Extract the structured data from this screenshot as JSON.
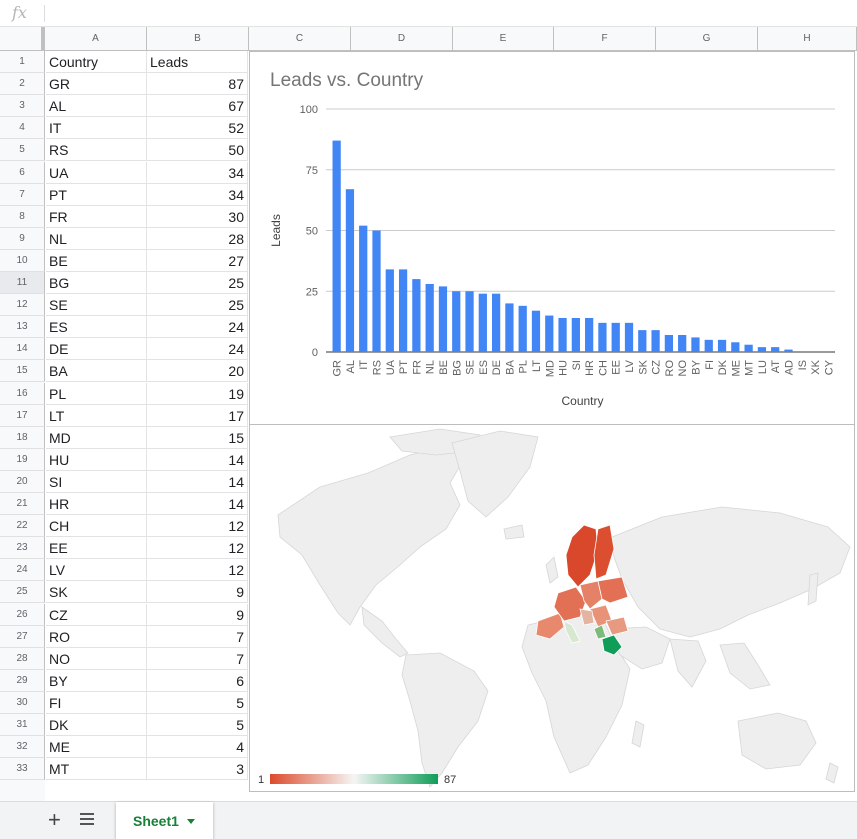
{
  "formula_bar": {
    "icon": "fx",
    "value": ""
  },
  "columns": [
    "A",
    "B",
    "C",
    "D",
    "E",
    "F",
    "G",
    "H"
  ],
  "header_row": {
    "country": "Country",
    "leads": "Leads"
  },
  "rows": [
    {
      "country": "GR",
      "leads": 87
    },
    {
      "country": "AL",
      "leads": 67
    },
    {
      "country": "IT",
      "leads": 52
    },
    {
      "country": "RS",
      "leads": 50
    },
    {
      "country": "UA",
      "leads": 34
    },
    {
      "country": "PT",
      "leads": 34
    },
    {
      "country": "FR",
      "leads": 30
    },
    {
      "country": "NL",
      "leads": 28
    },
    {
      "country": "BE",
      "leads": 27
    },
    {
      "country": "BG",
      "leads": 25
    },
    {
      "country": "SE",
      "leads": 25
    },
    {
      "country": "ES",
      "leads": 24
    },
    {
      "country": "DE",
      "leads": 24
    },
    {
      "country": "BA",
      "leads": 20
    },
    {
      "country": "PL",
      "leads": 19
    },
    {
      "country": "LT",
      "leads": 17
    },
    {
      "country": "MD",
      "leads": 15
    },
    {
      "country": "HU",
      "leads": 14
    },
    {
      "country": "SI",
      "leads": 14
    },
    {
      "country": "HR",
      "leads": 14
    },
    {
      "country": "CH",
      "leads": 12
    },
    {
      "country": "EE",
      "leads": 12
    },
    {
      "country": "LV",
      "leads": 12
    },
    {
      "country": "SK",
      "leads": 9
    },
    {
      "country": "CZ",
      "leads": 9
    },
    {
      "country": "RO",
      "leads": 7
    },
    {
      "country": "NO",
      "leads": 7
    },
    {
      "country": "BY",
      "leads": 6
    },
    {
      "country": "FI",
      "leads": 5
    },
    {
      "country": "DK",
      "leads": 5
    },
    {
      "country": "ME",
      "leads": 4
    },
    {
      "country": "MT",
      "leads": 3
    }
  ],
  "selected_row": 11,
  "chart_data": [
    {
      "type": "bar",
      "title": "Leads vs. Country",
      "xlabel": "Country",
      "ylabel": "Leads",
      "ylim": [
        0,
        100
      ],
      "yticks": [
        0,
        25,
        50,
        75,
        100
      ],
      "grid": true,
      "color": "#4285f4",
      "categories": [
        "GR",
        "AL",
        "IT",
        "RS",
        "UA",
        "PT",
        "FR",
        "NL",
        "BE",
        "BG",
        "SE",
        "ES",
        "DE",
        "BA",
        "PL",
        "LT",
        "MD",
        "HU",
        "SI",
        "HR",
        "CH",
        "EE",
        "LV",
        "SK",
        "CZ",
        "RO",
        "NO",
        "BY",
        "FI",
        "DK",
        "ME",
        "MT",
        "LU",
        "AT",
        "AD",
        "IS",
        "XK",
        "CY"
      ],
      "values": [
        87,
        67,
        52,
        50,
        34,
        34,
        30,
        28,
        27,
        25,
        25,
        24,
        24,
        20,
        19,
        17,
        15,
        14,
        14,
        14,
        12,
        12,
        12,
        9,
        9,
        7,
        7,
        6,
        5,
        5,
        4,
        3,
        2,
        2,
        1,
        0,
        0,
        0
      ]
    },
    {
      "type": "geo",
      "legend_min": "1",
      "legend_max": "87",
      "color_min": "#dc4b2b",
      "color_mid": "#f5f5f5",
      "color_max": "#0f9d58",
      "land_color": "#eeeeee"
    }
  ],
  "sheets": [
    {
      "label": "Sheet1"
    }
  ]
}
